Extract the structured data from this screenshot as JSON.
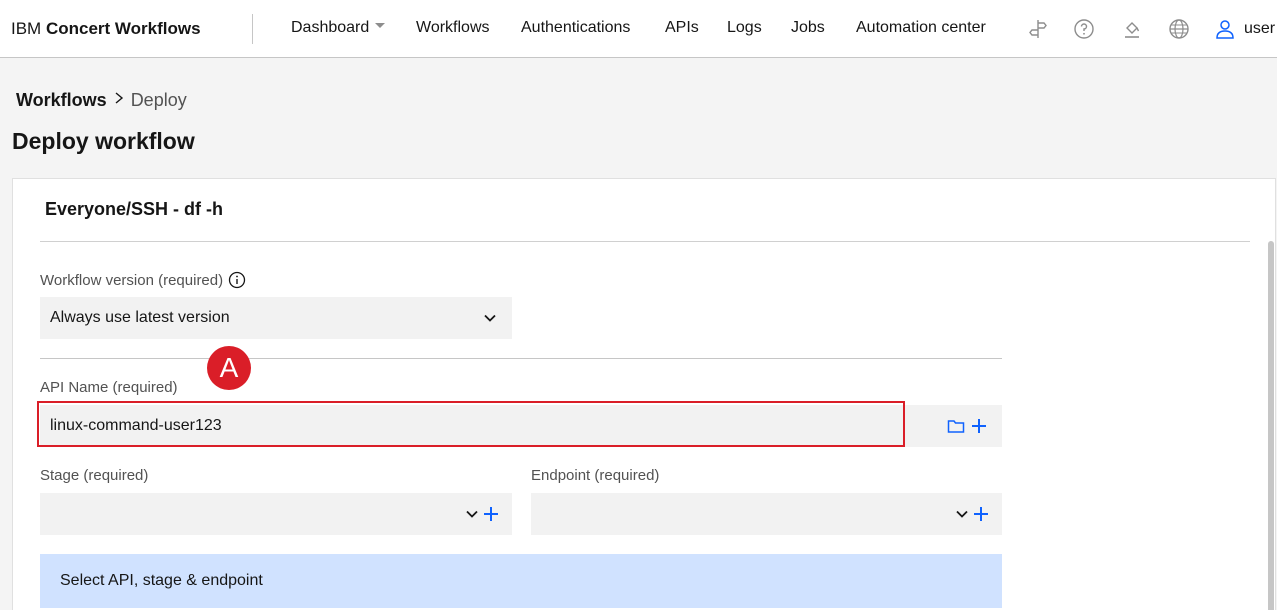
{
  "header": {
    "brand_prefix": "IBM",
    "brand_name": "Concert Workflows",
    "nav": [
      {
        "label": "Dashboard"
      },
      {
        "label": "Workflows"
      },
      {
        "label": "Authentications"
      },
      {
        "label": "APIs"
      },
      {
        "label": "Logs"
      },
      {
        "label": "Jobs"
      },
      {
        "label": "Automation center"
      }
    ],
    "user_label": "user"
  },
  "breadcrumb": {
    "parent": "Workflows",
    "current": "Deploy"
  },
  "page_title": "Deploy workflow",
  "card": {
    "title": "Everyone/SSH - df -h",
    "workflow_version": {
      "label": "Workflow version (required)",
      "value": "Always use latest version"
    },
    "api_name": {
      "label": "API Name (required)",
      "value": "linux-command-user123"
    },
    "stage": {
      "label": "Stage (required)",
      "value": ""
    },
    "endpoint": {
      "label": "Endpoint (required)",
      "value": ""
    },
    "banner": "Select API, stage & endpoint"
  },
  "annotation": {
    "marker": "A",
    "color": "#da1e28"
  },
  "colors": {
    "accent": "#0f62fe",
    "banner_bg": "#d0e2ff"
  }
}
